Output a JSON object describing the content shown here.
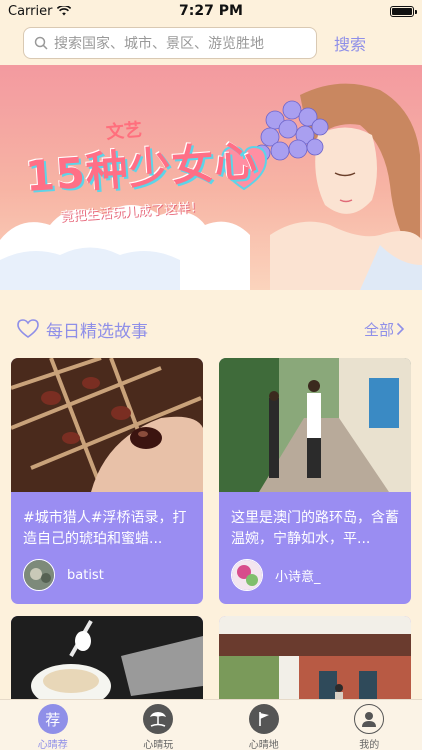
{
  "status_bar": {
    "carrier": "Carrier",
    "time": "7:27 PM"
  },
  "search": {
    "placeholder": "搜索国家、城市、景区、游览胜地",
    "button_label": "搜索"
  },
  "banner": {
    "title_small": "文艺",
    "title": "15种少女心",
    "subtitle": "竟把生活玩儿成了这样！"
  },
  "section": {
    "title": "每日精选故事",
    "see_all": "全部"
  },
  "cards": [
    {
      "text": "#城市猎人#浮桥语录，打造自己的琥珀和蜜蜡...",
      "username": "batist"
    },
    {
      "text": "这里是澳门的路环岛，含蓄温婉，宁静如水，平...",
      "username": "小诗意_"
    },
    {
      "text": "",
      "username": ""
    },
    {
      "text": "",
      "username": ""
    }
  ],
  "tabs": [
    {
      "label": "心晴荐",
      "icon": "recommend-icon",
      "glyph": "荐",
      "active": true
    },
    {
      "label": "心晴玩",
      "icon": "beach-icon",
      "active": false
    },
    {
      "label": "心晴地",
      "icon": "flag-icon",
      "active": false
    },
    {
      "label": "我的",
      "icon": "profile-icon",
      "active": false
    }
  ],
  "colors": {
    "accent": "#8f8fe8",
    "background": "#fdf1dc",
    "card": "#9a8df2"
  }
}
